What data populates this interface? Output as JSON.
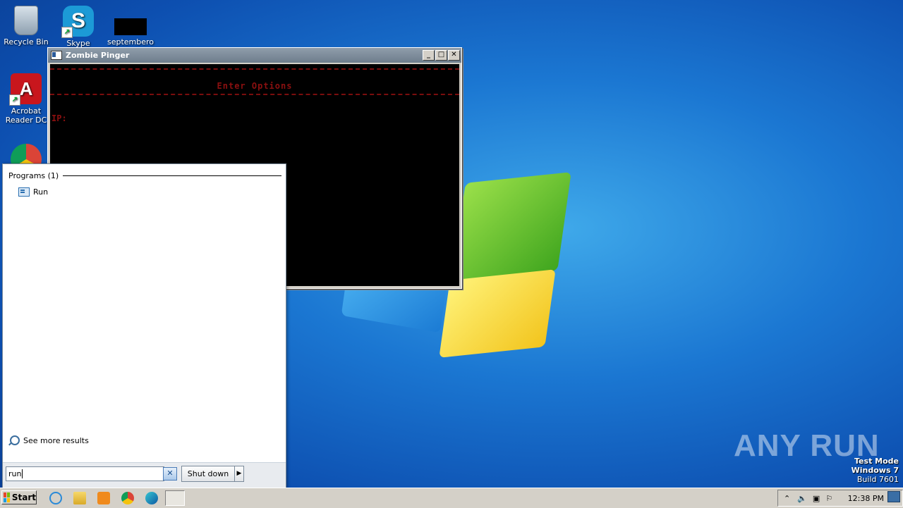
{
  "desktop": {
    "icons": [
      {
        "label": "Recycle Bin",
        "icon": "recycle-bin-icon"
      },
      {
        "label": "Skype",
        "icon": "skype-icon"
      },
      {
        "label": "septembero",
        "icon": "redacted-file-icon"
      },
      {
        "label": "Acrobat Reader DC",
        "icon": "acrobat-icon"
      },
      {
        "label": "",
        "icon": "chrome-icon"
      }
    ]
  },
  "console_window": {
    "title": "Zombie Pinger",
    "heading": "Enter Options",
    "prompt": "IP:",
    "colors": {
      "text": "#8b1010",
      "background": "#000000"
    }
  },
  "start_menu": {
    "section_header": "Programs (1)",
    "results": [
      {
        "label": "Run",
        "icon": "run-icon"
      }
    ],
    "see_more": "See more results",
    "search_value": "run",
    "clear_symbol": "✕",
    "shutdown_label": "Shut down",
    "shutdown_arrow": "▶"
  },
  "watermark": {
    "text": "ANY RUN"
  },
  "test_mode": {
    "line1": "Test Mode",
    "line2": "Windows 7",
    "line3": "Build 7601"
  },
  "taskbar": {
    "start_label": "Start",
    "pinned": [
      "ie-icon",
      "explorer-icon",
      "media-player-icon",
      "chrome-icon",
      "edge-icon",
      "console-app-icon"
    ],
    "tray_arrow": "⌃",
    "clock": "12:38 PM"
  }
}
